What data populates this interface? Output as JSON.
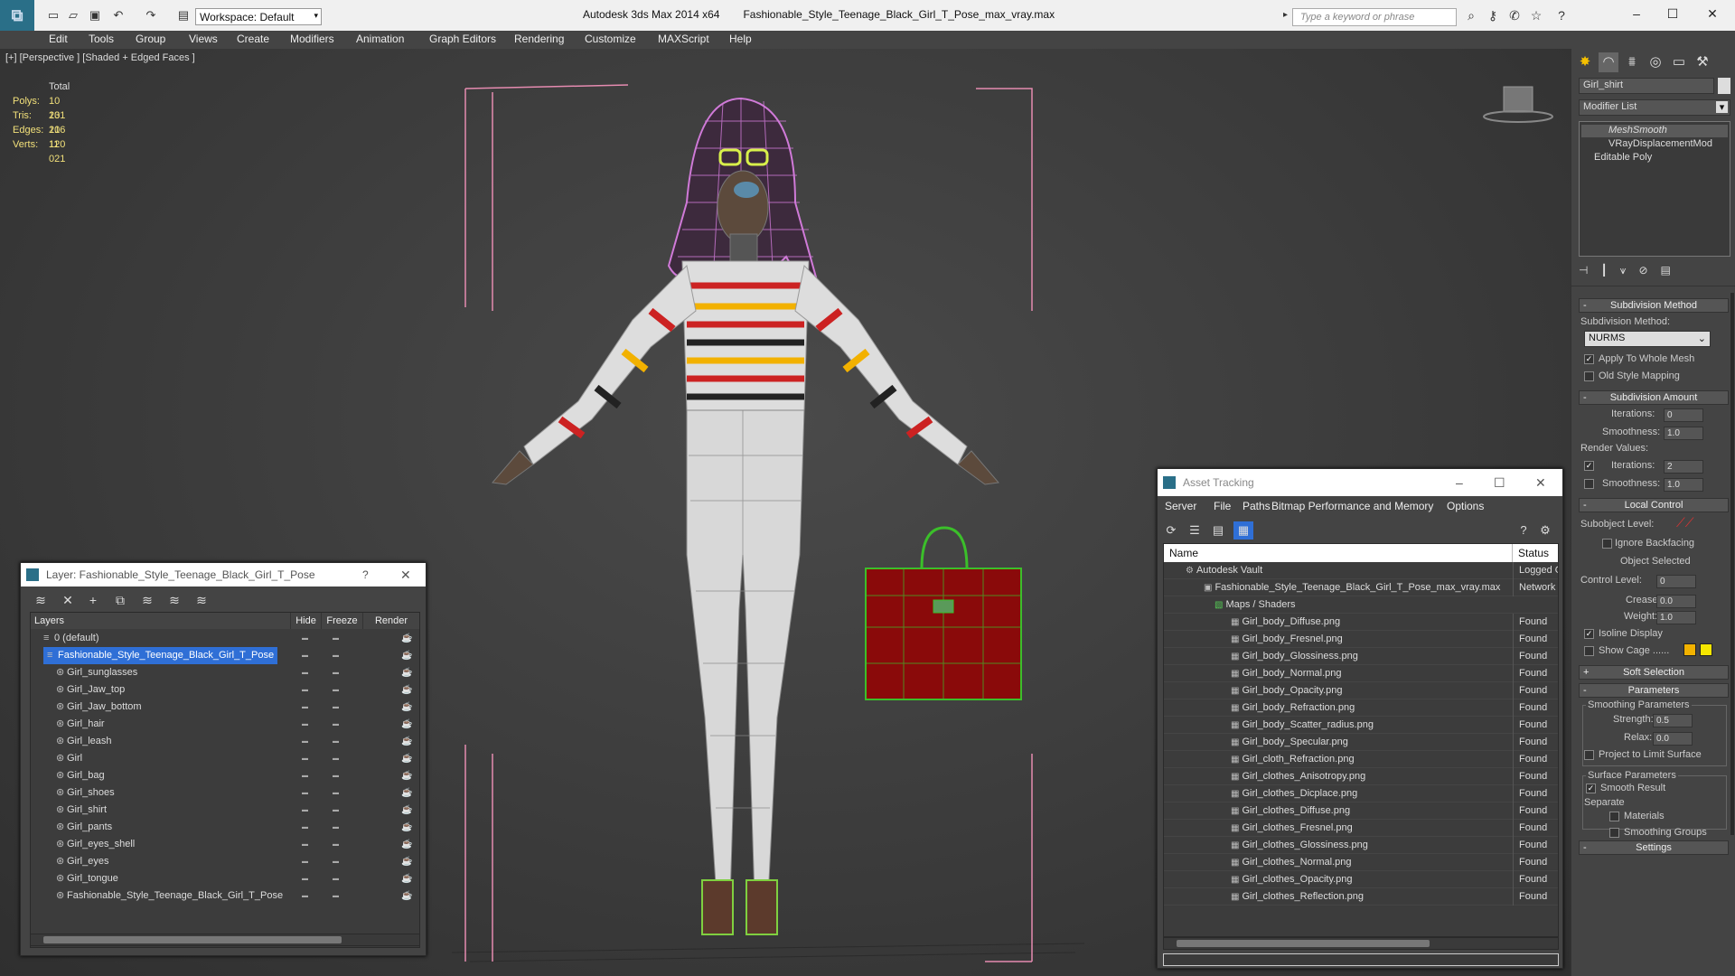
{
  "titlebar": {
    "workspace": "Workspace: Default",
    "app_name": "Autodesk 3ds Max  2014 x64",
    "file_name": "Fashionable_Style_Teenage_Black_Girl_T_Pose_max_vray.max",
    "search_placeholder": "Type a keyword or phrase"
  },
  "menu": [
    "Edit",
    "Tools",
    "Group",
    "Views",
    "Create",
    "Modifiers",
    "Animation",
    "Graph Editors",
    "Rendering",
    "Customize",
    "MAXScript",
    "Help"
  ],
  "viewport": {
    "label": "[+] [Perspective ] [Shaded + Edged Faces ]",
    "stats": {
      "header": "Total",
      "rows": [
        {
          "k": "Polys:",
          "v": "10 131"
        },
        {
          "k": "Tris:",
          "v": "20 106"
        },
        {
          "k": "Edges:",
          "v": "21 120"
        },
        {
          "k": "Verts:",
          "v": "11 021"
        }
      ]
    }
  },
  "command_panel": {
    "object_name": "Girl_shirt",
    "modifier_list": "Modifier List",
    "stack": [
      "MeshSmooth",
      "VRayDisplacementMod",
      "Editable Poly"
    ],
    "subdivision_method": {
      "title": "Subdivision Method",
      "label": "Subdivision Method:",
      "value": "NURMS",
      "apply_whole": "Apply To Whole Mesh",
      "old_style": "Old Style Mapping"
    },
    "subdivision_amount": {
      "title": "Subdivision Amount",
      "iterations_label": "Iterations:",
      "iterations": "0",
      "smoothness_label": "Smoothness:",
      "smoothness": "1.0",
      "render_values": "Render Values:",
      "r_iterations_label": "Iterations:",
      "r_iterations": "2",
      "r_smoothness_label": "Smoothness:",
      "r_smoothness": "1.0"
    },
    "local_control": {
      "title": "Local Control",
      "subobject_level": "Subobject Level:",
      "ignore_backfacing": "Ignore Backfacing",
      "object_selected": "Object Selected",
      "control_level": "Control Level:",
      "control_level_value": "0",
      "crease_label": "Crease:",
      "crease": "0.0",
      "weight_label": "Weight:",
      "weight": "1.0",
      "isoline": "Isoline Display",
      "show_cage": "Show Cage ......",
      "cage_color1": "#f2b200",
      "cage_color2": "#f5e600"
    },
    "soft_selection": "Soft Selection",
    "parameters": {
      "title": "Parameters",
      "smoothing_params": "Smoothing Parameters",
      "strength_label": "Strength:",
      "strength": "0.5",
      "relax_label": "Relax:",
      "relax": "0.0",
      "project": "Project to Limit Surface",
      "surface_params": "Surface Parameters",
      "smooth_result": "Smooth Result",
      "separate": "Separate",
      "materials": "Materials",
      "smoothing_groups": "Smoothing Groups"
    },
    "settings": "Settings"
  },
  "layer_window": {
    "title": "Layer: Fashionable_Style_Teenage_Black_Girl_T_Pose",
    "help": "?",
    "columns": [
      "Layers",
      "Hide",
      "Freeze",
      "Render"
    ],
    "rows": [
      {
        "name": "0 (default)",
        "level": 0
      },
      {
        "name": "Fashionable_Style_Teenage_Black_Girl_T_Pose",
        "level": 0,
        "selected": true
      },
      {
        "name": "Girl_sunglasses",
        "level": 1
      },
      {
        "name": "Girl_Jaw_top",
        "level": 1
      },
      {
        "name": "Girl_Jaw_bottom",
        "level": 1
      },
      {
        "name": "Girl_hair",
        "level": 1
      },
      {
        "name": "Girl_leash",
        "level": 1
      },
      {
        "name": "Girl",
        "level": 1
      },
      {
        "name": "Girl_bag",
        "level": 1
      },
      {
        "name": "Girl_shoes",
        "level": 1
      },
      {
        "name": "Girl_shirt",
        "level": 1
      },
      {
        "name": "Girl_pants",
        "level": 1
      },
      {
        "name": "Girl_eyes_shell",
        "level": 1
      },
      {
        "name": "Girl_eyes",
        "level": 1
      },
      {
        "name": "Girl_tongue",
        "level": 1
      },
      {
        "name": "Fashionable_Style_Teenage_Black_Girl_T_Pose",
        "level": 1
      }
    ]
  },
  "asset_window": {
    "title": "Asset Tracking",
    "menu": [
      "Server",
      "File",
      "Paths",
      "Bitmap Performance and Memory",
      "Options"
    ],
    "columns": [
      "Name",
      "Status"
    ],
    "rows": [
      {
        "name": "Autodesk Vault",
        "status": "Logged O",
        "level": 0
      },
      {
        "name": "Fashionable_Style_Teenage_Black_Girl_T_Pose_max_vray.max",
        "status": "Network F",
        "level": 1
      },
      {
        "name": "Maps / Shaders",
        "status": "",
        "level": 2
      },
      {
        "name": "Girl_body_Diffuse.png",
        "status": "Found",
        "level": 3
      },
      {
        "name": "Girl_body_Fresnel.png",
        "status": "Found",
        "level": 3
      },
      {
        "name": "Girl_body_Glossiness.png",
        "status": "Found",
        "level": 3
      },
      {
        "name": "Girl_body_Normal.png",
        "status": "Found",
        "level": 3
      },
      {
        "name": "Girl_body_Opacity.png",
        "status": "Found",
        "level": 3
      },
      {
        "name": "Girl_body_Refraction.png",
        "status": "Found",
        "level": 3
      },
      {
        "name": "Girl_body_Scatter_radius.png",
        "status": "Found",
        "level": 3
      },
      {
        "name": "Girl_body_Specular.png",
        "status": "Found",
        "level": 3
      },
      {
        "name": "Girl_cloth_Refraction.png",
        "status": "Found",
        "level": 3
      },
      {
        "name": "Girl_clothes_Anisotropy.png",
        "status": "Found",
        "level": 3
      },
      {
        "name": "Girl_clothes_Dicplace.png",
        "status": "Found",
        "level": 3
      },
      {
        "name": "Girl_clothes_Diffuse.png",
        "status": "Found",
        "level": 3
      },
      {
        "name": "Girl_clothes_Fresnel.png",
        "status": "Found",
        "level": 3
      },
      {
        "name": "Girl_clothes_Glossiness.png",
        "status": "Found",
        "level": 3
      },
      {
        "name": "Girl_clothes_Normal.png",
        "status": "Found",
        "level": 3
      },
      {
        "name": "Girl_clothes_Opacity.png",
        "status": "Found",
        "level": 3
      },
      {
        "name": "Girl_clothes_Reflection.png",
        "status": "Found",
        "level": 3
      }
    ]
  }
}
